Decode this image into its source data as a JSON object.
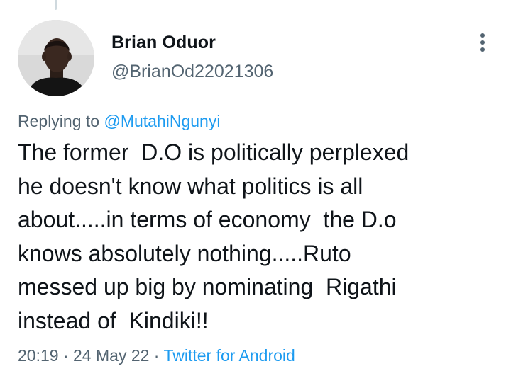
{
  "tweet": {
    "author": {
      "display_name": "Brian Oduor",
      "handle": "@BrianOd22021306",
      "avatar_icon": "user-avatar-photo"
    },
    "replying": {
      "prefix": "Replying to ",
      "mention": "@MutahiNgunyi"
    },
    "lines": [
      "The former  D.O is politically perplexed",
      "he doesn't know what politics is all",
      "about.....in terms of economy  the D.o",
      "knows absolutely nothing.....Ruto",
      "messed up big by nominating  Rigathi",
      "instead of  Kindiki!!"
    ],
    "meta": {
      "time": "20:19",
      "separator1": " · ",
      "date": "24 May 22",
      "separator2": " · ",
      "source": "Twitter for Android"
    },
    "more_icon": "more-options-vertical-icon"
  },
  "colors": {
    "text": "#0f1419",
    "secondary": "#536471",
    "link": "#1d9bf0"
  }
}
